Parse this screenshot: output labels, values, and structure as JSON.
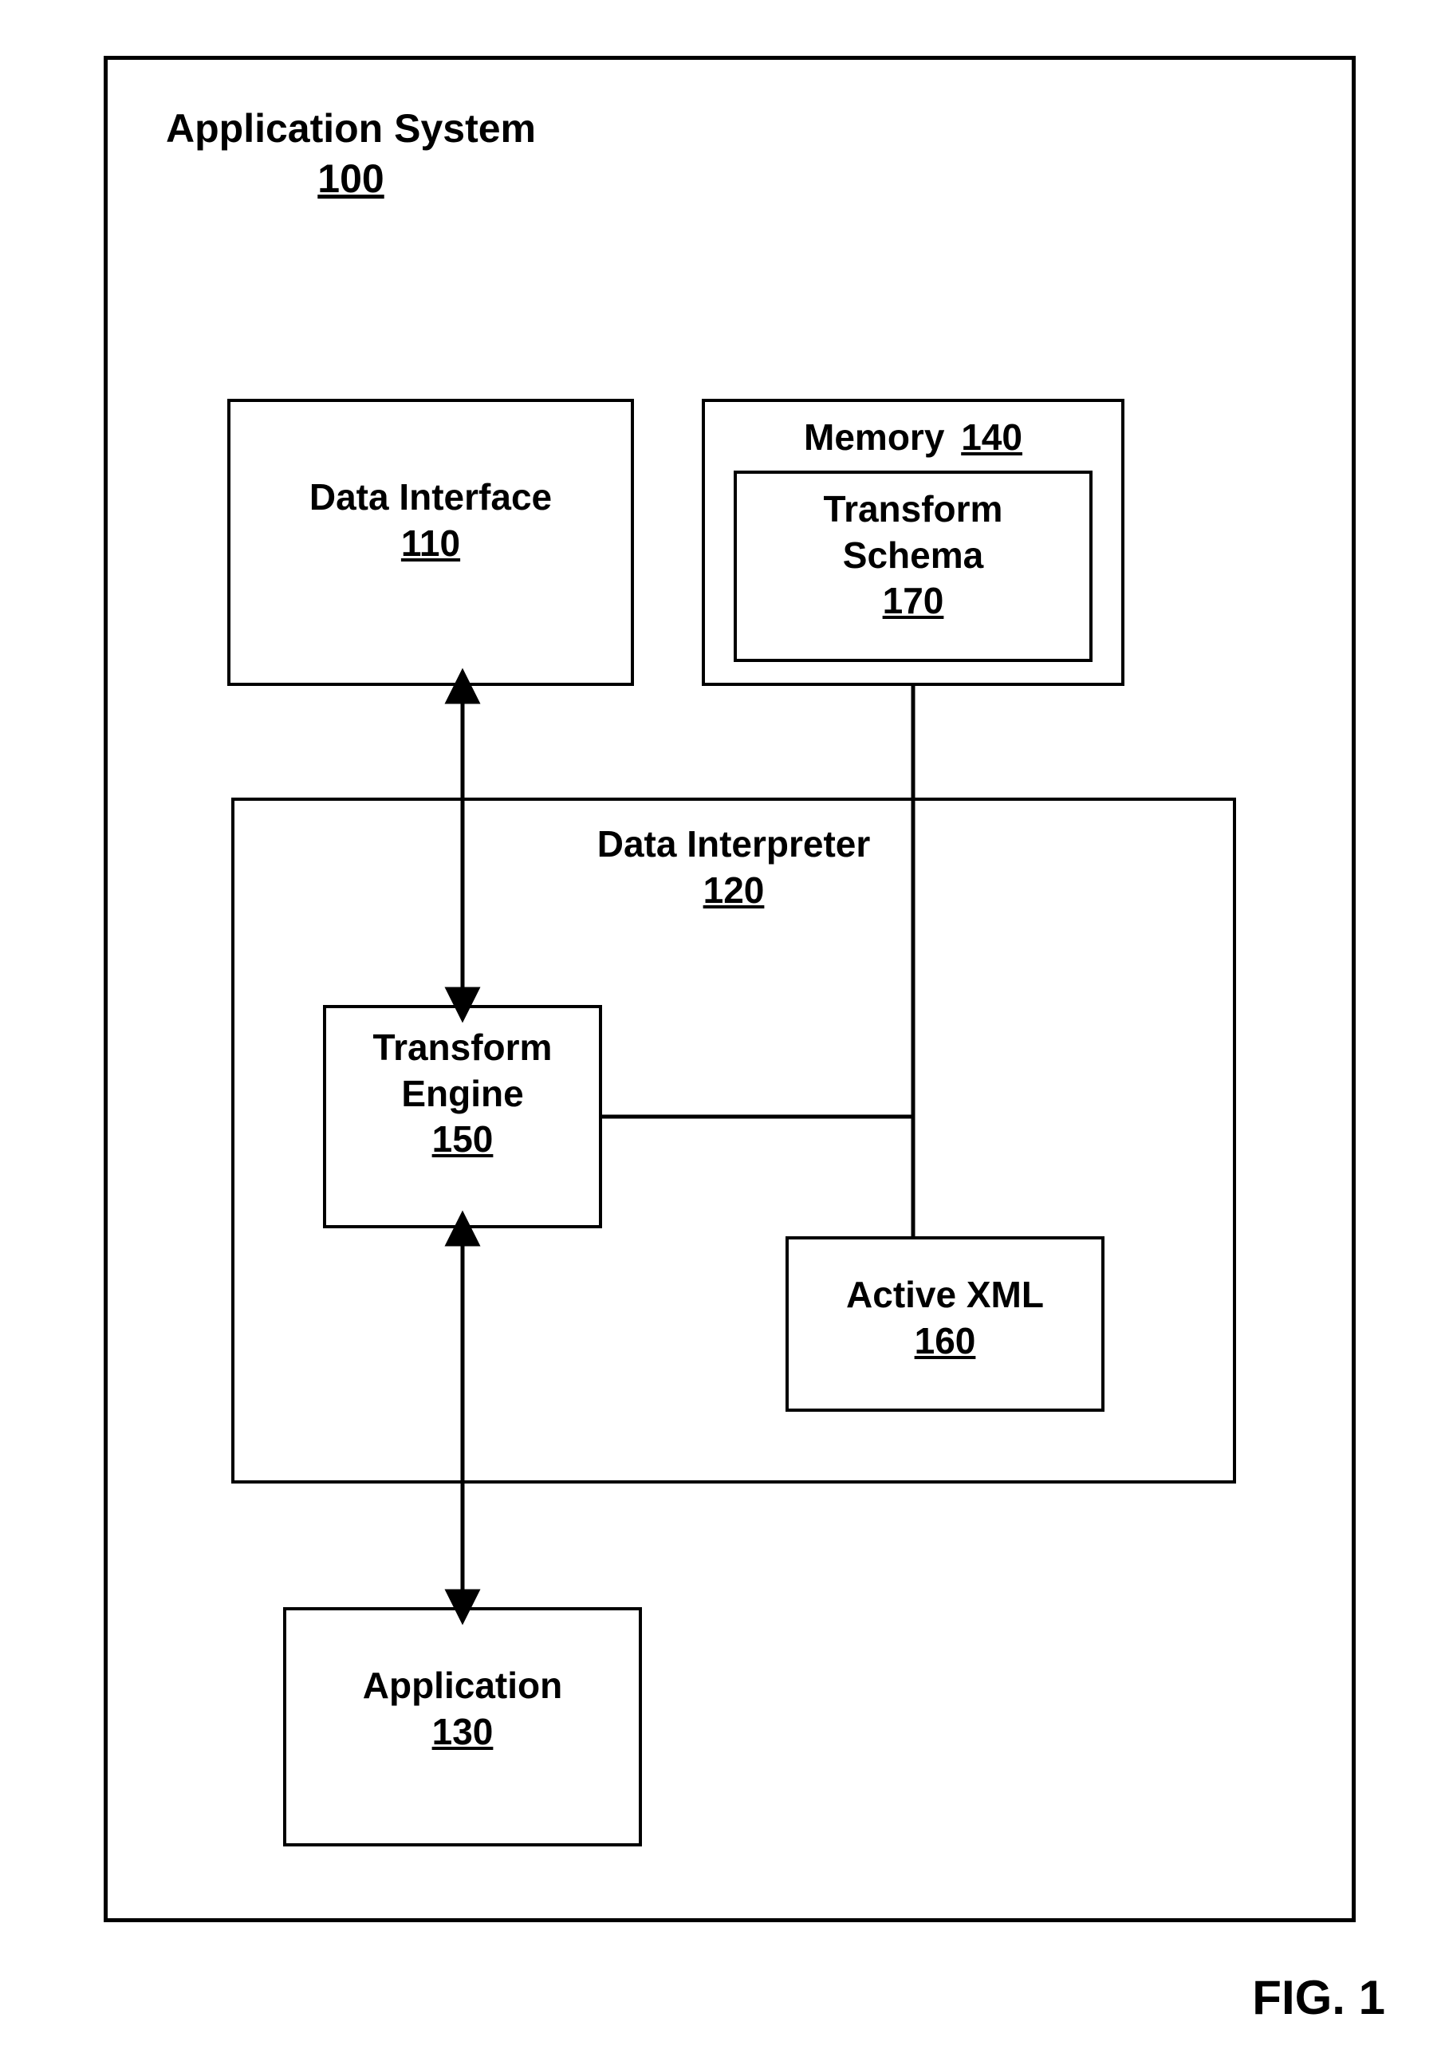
{
  "figure_label": "FIG. 1",
  "system": {
    "title": "Application System",
    "ref": "100"
  },
  "blocks": {
    "data_interface": {
      "title": "Data Interface",
      "ref": "110"
    },
    "memory": {
      "title": "Memory",
      "ref": "140"
    },
    "transform_schema": {
      "title": "Transform Schema",
      "ref": "170"
    },
    "data_interpreter": {
      "title": "Data Interpreter",
      "ref": "120"
    },
    "transform_engine": {
      "title": "Transform Engine",
      "ref": "150"
    },
    "active_xml": {
      "title": "Active XML",
      "ref": "160"
    },
    "application": {
      "title": "Application",
      "ref": "130"
    }
  }
}
